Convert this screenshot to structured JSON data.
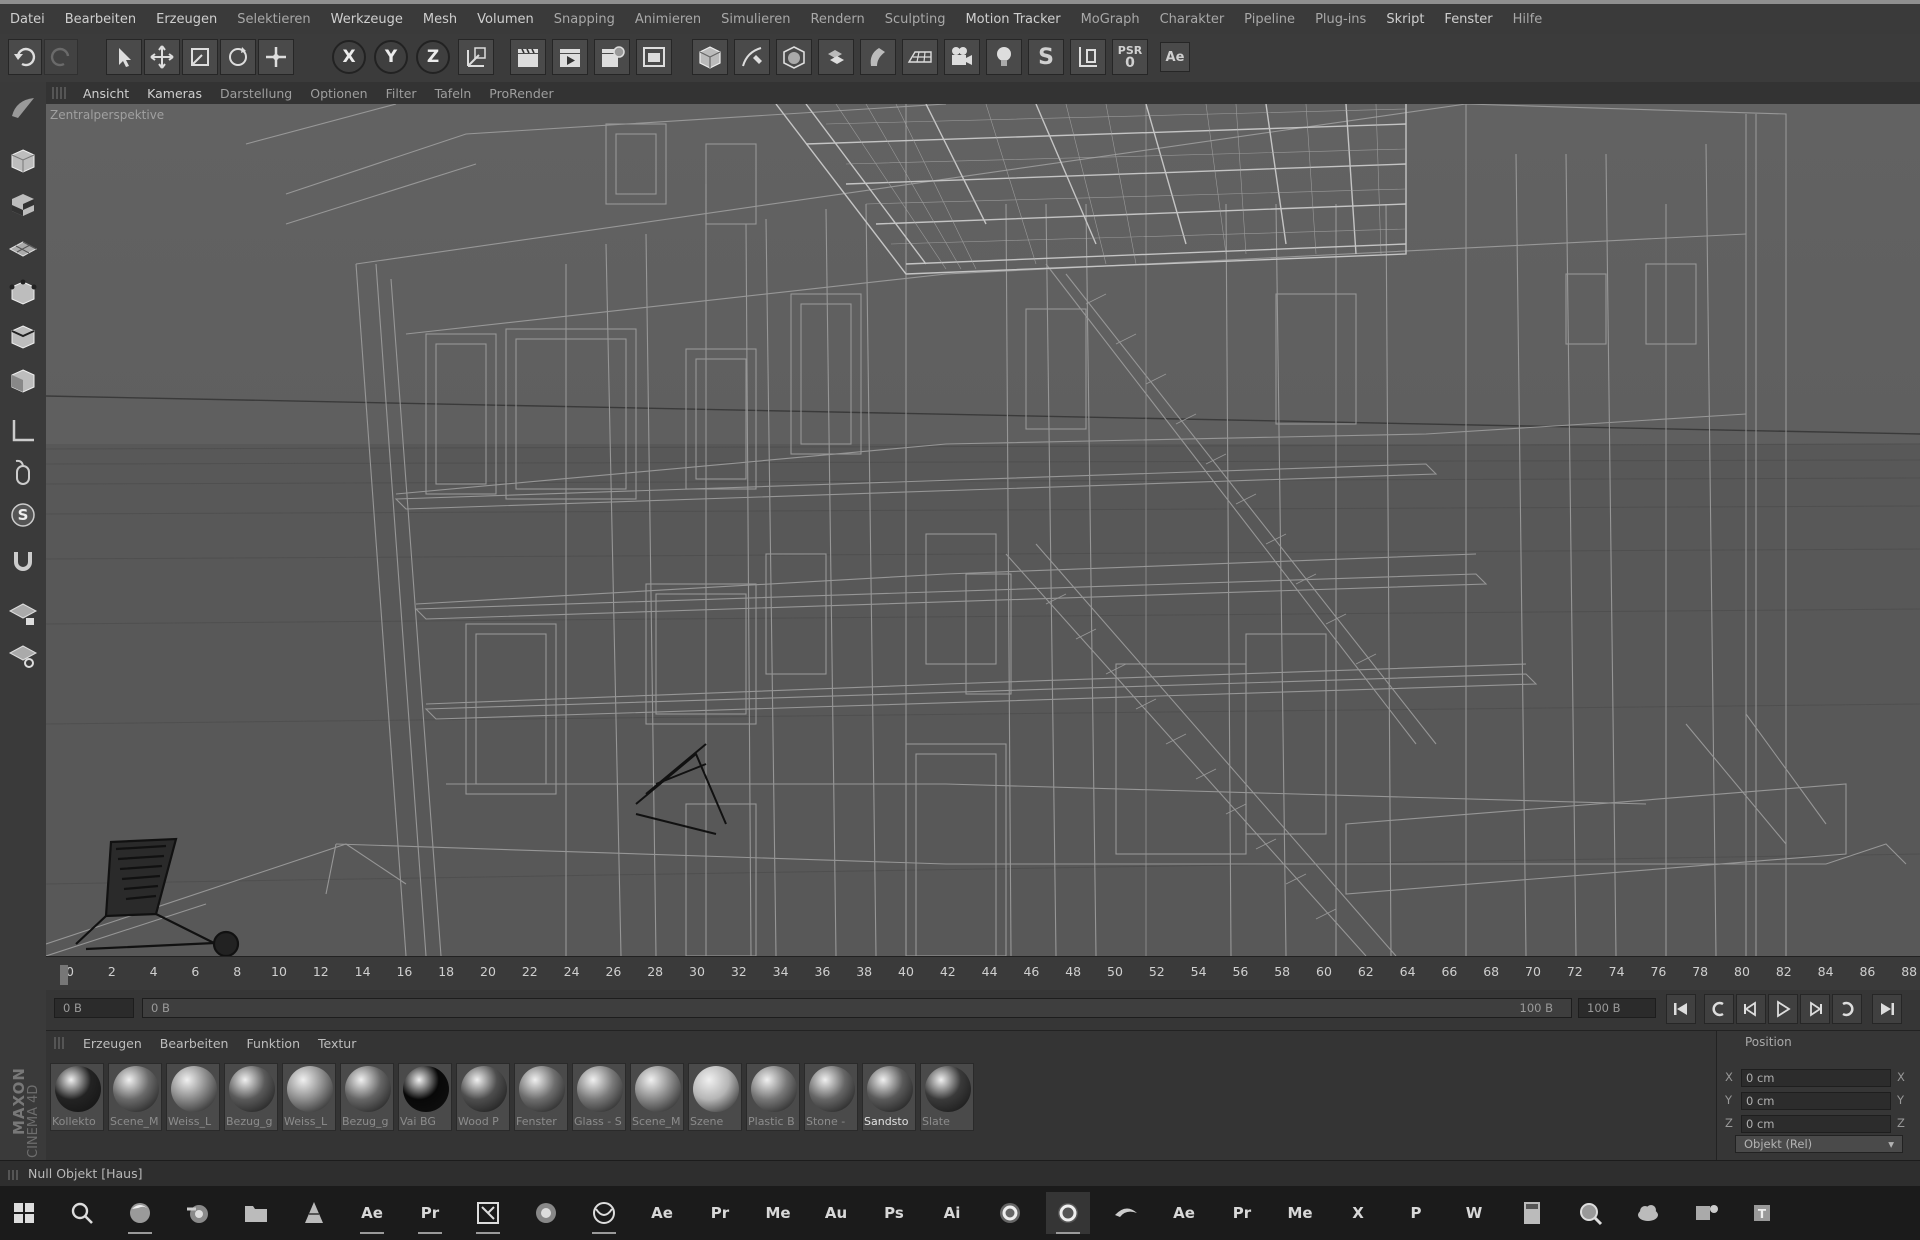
{
  "menubar": {
    "items": [
      "Datei",
      "Bearbeiten",
      "Erzeugen",
      "Selektieren",
      "Werkzeuge",
      "Mesh",
      "Volumen",
      "Snapping",
      "Animieren",
      "Simulieren",
      "Rendern",
      "Sculpting",
      "Motion Tracker",
      "MoGraph",
      "Charakter",
      "Pipeline",
      "Plug-ins",
      "Skript",
      "Fenster",
      "Hilfe"
    ]
  },
  "toolbar": {
    "axis_x": "X",
    "axis_y": "Y",
    "axis_z": "Z",
    "psr_label": "PSR",
    "psr_value": "0",
    "ae_label": "Ae",
    "s_label": "S"
  },
  "viewport": {
    "menu": [
      "Ansicht",
      "Kameras",
      "Darstellung",
      "Optionen",
      "Filter",
      "Tafeln",
      "ProRender"
    ],
    "label": "Zentralperspektive"
  },
  "timeline": {
    "ticks": [
      "0",
      "2",
      "4",
      "6",
      "8",
      "10",
      "12",
      "14",
      "16",
      "18",
      "20",
      "22",
      "24",
      "26",
      "28",
      "30",
      "32",
      "34",
      "36",
      "38",
      "40",
      "42",
      "44",
      "46",
      "48",
      "50",
      "52",
      "54",
      "56",
      "58",
      "60",
      "62",
      "64",
      "66",
      "68",
      "70",
      "72",
      "74",
      "76",
      "78",
      "80",
      "82",
      "84",
      "86",
      "88"
    ]
  },
  "playback": {
    "current_frame": "0 B",
    "range_start": "0 B",
    "range_end": "100 B",
    "end_frame": "100 B"
  },
  "materials": {
    "menu": [
      "Erzeugen",
      "Bearbeiten",
      "Funktion",
      "Textur"
    ],
    "items": [
      {
        "name": "Kollekto",
        "color": "#232323"
      },
      {
        "name": "Scene_M",
        "color": "#6a6a6a"
      },
      {
        "name": "Weiss_L",
        "color": "#8a8a8a"
      },
      {
        "name": "Bezug_g",
        "color": "#5a5a5a"
      },
      {
        "name": "Weiss_L",
        "color": "#8e8e8e"
      },
      {
        "name": "Bezug_g",
        "color": "#666666"
      },
      {
        "name": "Vai BG",
        "color": "#080808"
      },
      {
        "name": "Wood P",
        "color": "#4e4e4e"
      },
      {
        "name": "Fenster",
        "color": "#6e6e6e"
      },
      {
        "name": "Glass - S",
        "color": "#7a7a7a"
      },
      {
        "name": "Scene_M",
        "color": "#8a8a8a"
      },
      {
        "name": "Szene",
        "color": "#b5b5b5"
      },
      {
        "name": "Plastic B",
        "color": "#777777"
      },
      {
        "name": "Stone -",
        "color": "#666666"
      },
      {
        "name": "Sandsto",
        "color": "#5a5a5a",
        "selected": true
      },
      {
        "name": "Slate",
        "color": "#3a3a3a"
      }
    ]
  },
  "coordinates": {
    "title": "Position",
    "rows": [
      {
        "axis": "X",
        "value": "0 cm"
      },
      {
        "axis": "Y",
        "value": "0 cm"
      },
      {
        "axis": "Z",
        "value": "0 cm"
      }
    ],
    "mode": "Objekt (Rel)"
  },
  "brand": {
    "line1": "MAXON",
    "line2": "CINEMA 4D"
  },
  "status": {
    "text": "Null Objekt [Haus]"
  },
  "taskbar": {
    "apps": [
      {
        "name": "windows-start-icon",
        "label": ""
      },
      {
        "name": "search-icon",
        "label": ""
      },
      {
        "name": "firefox-icon",
        "label": ""
      },
      {
        "name": "blender-icon",
        "label": ""
      },
      {
        "name": "file-explorer-icon",
        "label": ""
      },
      {
        "name": "vlc-icon",
        "label": ""
      },
      {
        "name": "after-effects-app",
        "label": "Ae"
      },
      {
        "name": "premiere-app",
        "label": "Pr"
      },
      {
        "name": "media-app-icon",
        "label": ""
      },
      {
        "name": "cinebench-icon",
        "label": ""
      },
      {
        "name": "chrome-icon",
        "label": ""
      },
      {
        "name": "after-effects-cc-app",
        "label": "Ae"
      },
      {
        "name": "premiere-cc-app",
        "label": "Pr"
      },
      {
        "name": "media-encoder-app",
        "label": "Me"
      },
      {
        "name": "audition-app",
        "label": "Au"
      },
      {
        "name": "photoshop-app",
        "label": "Ps"
      },
      {
        "name": "illustrator-app",
        "label": "Ai"
      },
      {
        "name": "davinci-icon",
        "label": ""
      },
      {
        "name": "cinema4d-icon",
        "label": ""
      },
      {
        "name": "motion-icon",
        "label": ""
      },
      {
        "name": "after-effects-2-app",
        "label": "Ae"
      },
      {
        "name": "premiere-2-app",
        "label": "Pr"
      },
      {
        "name": "media-encoder-2-app",
        "label": "Me"
      },
      {
        "name": "excel-app",
        "label": "X"
      },
      {
        "name": "powerpoint-app",
        "label": "P"
      },
      {
        "name": "word-app",
        "label": "W"
      },
      {
        "name": "calculator-icon",
        "label": ""
      },
      {
        "name": "magnifier-icon",
        "label": ""
      },
      {
        "name": "cloud-icon",
        "label": ""
      },
      {
        "name": "teams-icon",
        "label": ""
      },
      {
        "name": "teams-2-icon",
        "label": ""
      }
    ]
  },
  "colors": {
    "viewport_bg": "#5e5e5e",
    "panel_bg": "#343434",
    "wire": "#b3b3b3"
  }
}
